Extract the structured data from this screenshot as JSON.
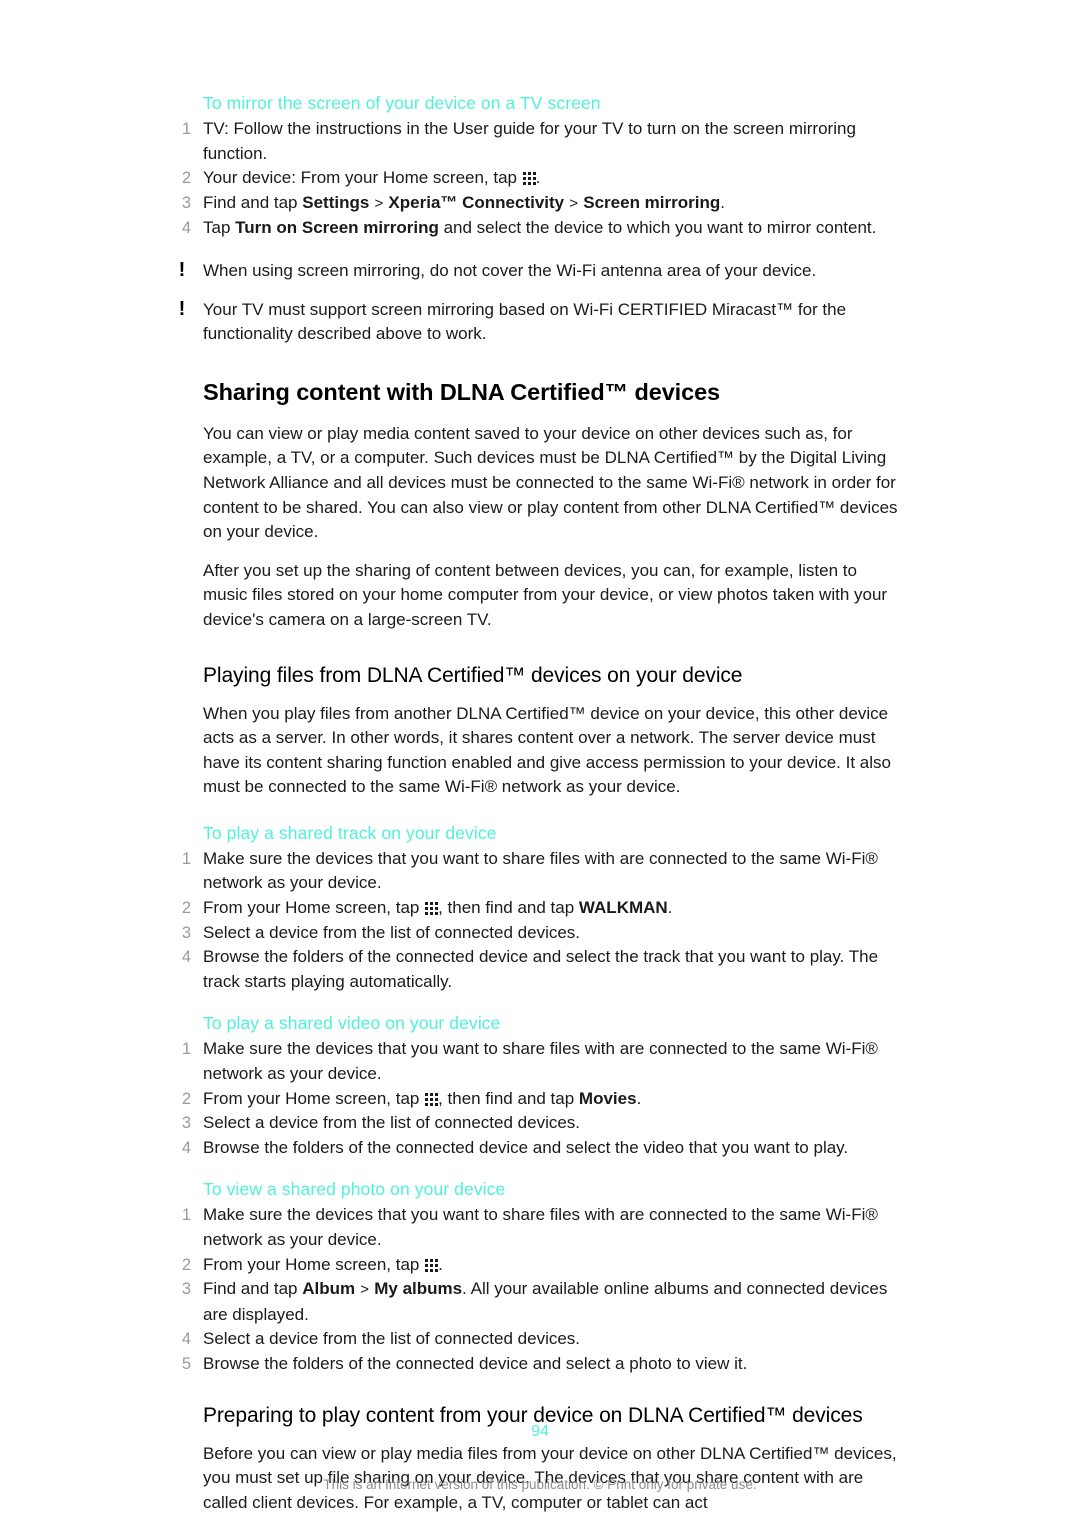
{
  "document": {
    "page_number": "94",
    "footer_note": "This is an Internet version of this publication. © Print only for private use.",
    "accent_color": "#4ff2d8",
    "body_color": "#1a1a1a",
    "number_color": "#9a9a9a"
  },
  "icons": {
    "app_drawer": "app-drawer-icon",
    "note": "!"
  },
  "sections": {
    "mirror_procedure": {
      "heading": "To mirror the screen of your device on a TV screen",
      "steps": [
        {
          "num": "1",
          "parts": [
            {
              "t": "text",
              "v": "TV: Follow the instructions in the User guide for your TV to turn on the screen mirroring function."
            }
          ]
        },
        {
          "num": "2",
          "parts": [
            {
              "t": "text",
              "v": "Your device: From your Home screen, tap "
            },
            {
              "t": "icon",
              "v": "app-drawer-icon"
            },
            {
              "t": "text",
              "v": "."
            }
          ]
        },
        {
          "num": "3",
          "parts": [
            {
              "t": "text",
              "v": "Find and tap "
            },
            {
              "t": "bold",
              "v": "Settings"
            },
            {
              "t": "sep",
              "v": ">"
            },
            {
              "t": "bold",
              "v": "Xperia™ Connectivity"
            },
            {
              "t": "sep",
              "v": ">"
            },
            {
              "t": "bold",
              "v": "Screen mirroring"
            },
            {
              "t": "text",
              "v": "."
            }
          ]
        },
        {
          "num": "4",
          "parts": [
            {
              "t": "text",
              "v": "Tap "
            },
            {
              "t": "bold",
              "v": "Turn on Screen mirroring"
            },
            {
              "t": "text",
              "v": " and select the device to which you want to mirror content."
            }
          ]
        }
      ]
    },
    "notes": [
      {
        "icon": "!",
        "text": "When using screen mirroring, do not cover the Wi-Fi antenna area of your device."
      },
      {
        "icon": "!",
        "text": "Your TV must support screen mirroring based on Wi-Fi CERTIFIED Miracast™ for the functionality described above to work."
      }
    ],
    "dlna_sharing": {
      "heading": "Sharing content with DLNA Certified™ devices",
      "paragraphs": [
        "You can view or play media content saved to your device on other devices such as, for example, a TV, or a computer. Such devices must be DLNA Certified™ by the Digital Living Network Alliance and all devices must be connected to the same Wi-Fi® network in order for content to be shared. You can also view or play content from other DLNA Certified™ devices on your device.",
        "After you set up the sharing of content between devices, you can, for example, listen to music files stored on your home computer from your device, or view photos taken with your device's camera on a large-screen TV."
      ]
    },
    "playing_files": {
      "heading": "Playing files from DLNA Certified™ devices on your device",
      "paragraphs": [
        "When you play files from another DLNA Certified™ device on your device, this other device acts as a server. In other words, it shares content over a network. The server device must have its content sharing function enabled and give access permission to your device. It also must be connected to the same Wi-Fi® network as your device."
      ]
    },
    "shared_track": {
      "heading": "To play a shared track on your device",
      "steps": [
        {
          "num": "1",
          "parts": [
            {
              "t": "text",
              "v": "Make sure the devices that you want to share files with are connected to the same Wi-Fi® network as your device."
            }
          ]
        },
        {
          "num": "2",
          "parts": [
            {
              "t": "text",
              "v": "From your Home screen, tap "
            },
            {
              "t": "icon",
              "v": "app-drawer-icon"
            },
            {
              "t": "text",
              "v": ", then find and tap "
            },
            {
              "t": "bold",
              "v": "WALKMAN"
            },
            {
              "t": "text",
              "v": "."
            }
          ]
        },
        {
          "num": "3",
          "parts": [
            {
              "t": "text",
              "v": "Select a device from the list of connected devices."
            }
          ]
        },
        {
          "num": "4",
          "parts": [
            {
              "t": "text",
              "v": "Browse the folders of the connected device and select the track that you want to play. The track starts playing automatically."
            }
          ]
        }
      ]
    },
    "shared_video": {
      "heading": "To play a shared video on your device",
      "steps": [
        {
          "num": "1",
          "parts": [
            {
              "t": "text",
              "v": "Make sure the devices that you want to share files with are connected to the same Wi-Fi® network as your device."
            }
          ]
        },
        {
          "num": "2",
          "parts": [
            {
              "t": "text",
              "v": "From your Home screen, tap "
            },
            {
              "t": "icon",
              "v": "app-drawer-icon"
            },
            {
              "t": "text",
              "v": ", then find and tap "
            },
            {
              "t": "bold",
              "v": "Movies"
            },
            {
              "t": "text",
              "v": "."
            }
          ]
        },
        {
          "num": "3",
          "parts": [
            {
              "t": "text",
              "v": "Select a device from the list of connected devices."
            }
          ]
        },
        {
          "num": "4",
          "parts": [
            {
              "t": "text",
              "v": "Browse the folders of the connected device and select the video that you want to play."
            }
          ]
        }
      ]
    },
    "shared_photo": {
      "heading": "To view a shared photo on your device",
      "steps": [
        {
          "num": "1",
          "parts": [
            {
              "t": "text",
              "v": "Make sure the devices that you want to share files with are connected to the same Wi-Fi® network as your device."
            }
          ]
        },
        {
          "num": "2",
          "parts": [
            {
              "t": "text",
              "v": "From your Home screen, tap "
            },
            {
              "t": "icon",
              "v": "app-drawer-icon"
            },
            {
              "t": "text",
              "v": "."
            }
          ]
        },
        {
          "num": "3",
          "parts": [
            {
              "t": "text",
              "v": "Find and tap "
            },
            {
              "t": "bold",
              "v": "Album"
            },
            {
              "t": "sep",
              "v": ">"
            },
            {
              "t": "bold",
              "v": "My albums"
            },
            {
              "t": "text",
              "v": ". All your available online albums and connected devices are displayed."
            }
          ]
        },
        {
          "num": "4",
          "parts": [
            {
              "t": "text",
              "v": "Select a device from the list of connected devices."
            }
          ]
        },
        {
          "num": "5",
          "parts": [
            {
              "t": "text",
              "v": "Browse the folders of the connected device and select a photo to view it."
            }
          ]
        }
      ]
    },
    "preparing": {
      "heading": "Preparing to play content from your device on DLNA Certified™ devices",
      "paragraphs": [
        "Before you can view or play media files from your device on other DLNA Certified™ devices, you must set up file sharing on your device. The devices that you share content with are called client devices. For example, a TV, computer or tablet can act"
      ]
    }
  }
}
